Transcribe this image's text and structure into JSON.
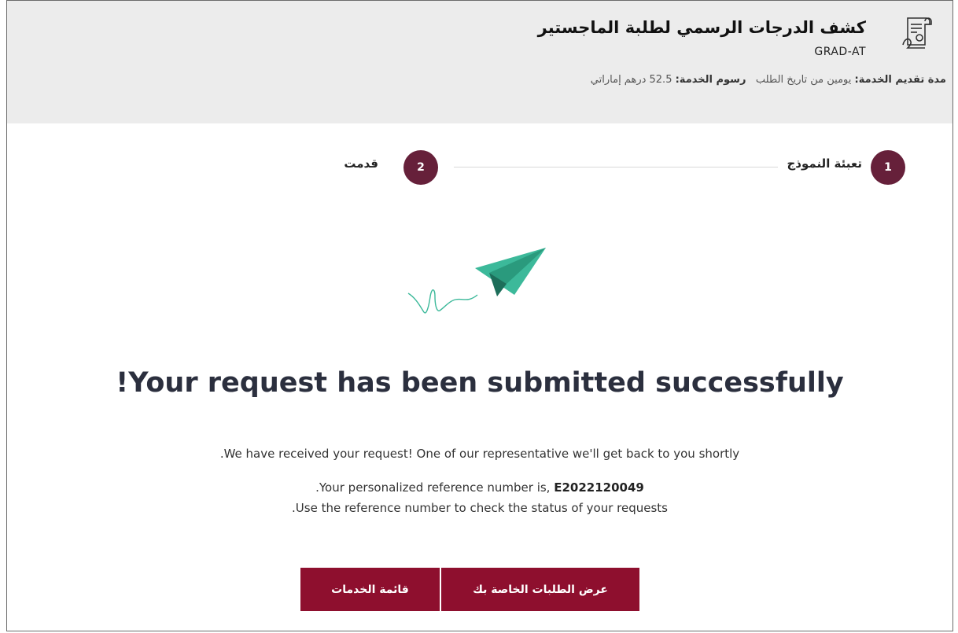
{
  "header": {
    "title": "كشف الدرجات الرسمي لطلبة الماجستير",
    "code": "GRAD-AT",
    "duration_label": "مدة تقديم الخدمة:",
    "duration_value": "يومين من تاريخ الطلب",
    "fee_label": "رسوم الخدمة:",
    "fee_value": "52.5 درهم إماراتي",
    "icon": "document-certificate-icon"
  },
  "steps": [
    {
      "number": "1",
      "label": "تعبئة النموذج"
    },
    {
      "number": "2",
      "label": "قدمت"
    }
  ],
  "confirmation": {
    "icon": "paper-plane-icon",
    "headline": "!Your request has been submitted successfully",
    "message": ".We have received your request! One of our representative we'll get back to you shortly",
    "reference_prefix": ".Your personalized reference number is,",
    "reference_number": "E2022120049",
    "reference_hint": ".Use the reference number to check the status of your requests"
  },
  "buttons": {
    "view_requests": "عرض الطلبات الخاصة بك",
    "services_list": "قائمة الخدمات"
  },
  "colors": {
    "accent": "#8e0f2e",
    "step": "#66203a",
    "plane": "#3cb99a",
    "header_bg": "#ececec"
  }
}
